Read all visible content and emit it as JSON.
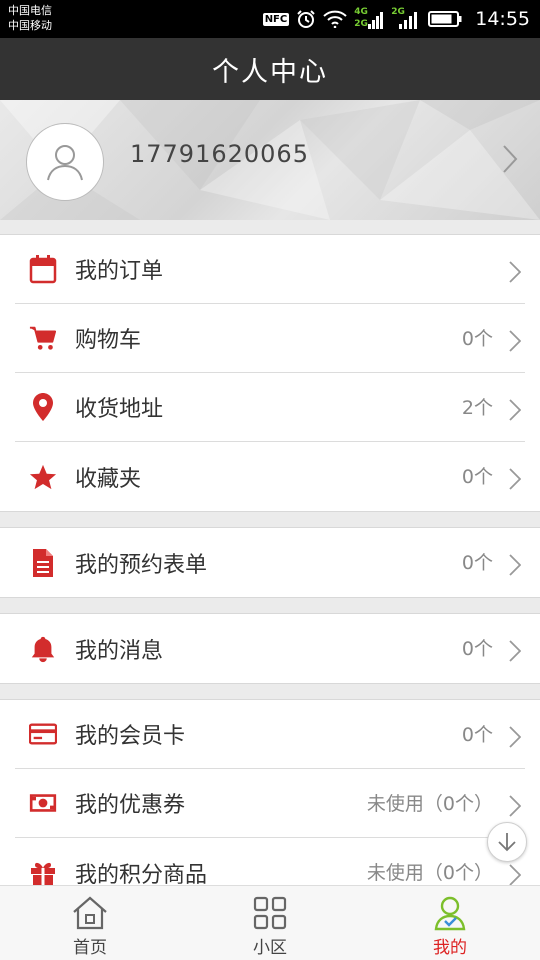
{
  "status_bar": {
    "carrier1": "中国电信",
    "carrier2": "中国移动",
    "nfc": "NFC",
    "net1": "4G",
    "net1b": "2G",
    "net2": "2G",
    "time": "14:55"
  },
  "header": {
    "title": "个人中心"
  },
  "profile": {
    "phone": "17791620065"
  },
  "accent_color": "#d22c2c",
  "sections": [
    {
      "items": [
        {
          "icon": "calendar-icon",
          "label": "我的订单",
          "count": ""
        },
        {
          "icon": "cart-icon",
          "label": "购物车",
          "count": "0个"
        },
        {
          "icon": "location-pin-icon",
          "label": "收货地址",
          "count": "2个"
        },
        {
          "icon": "star-icon",
          "label": "收藏夹",
          "count": "0个"
        }
      ]
    },
    {
      "items": [
        {
          "icon": "document-icon",
          "label": "我的预约表单",
          "count": "0个"
        }
      ]
    },
    {
      "items": [
        {
          "icon": "bell-icon",
          "label": "我的消息",
          "count": "0个"
        }
      ]
    },
    {
      "items": [
        {
          "icon": "card-icon",
          "label": "我的会员卡",
          "count": "0个"
        },
        {
          "icon": "coupon-icon",
          "label": "我的优惠券",
          "count": "未使用（0个）"
        },
        {
          "icon": "gift-icon",
          "label": "我的积分商品",
          "count": "未使用（0个）"
        }
      ]
    }
  ],
  "bottom_nav": {
    "items": [
      {
        "icon": "home-icon",
        "label": "首页"
      },
      {
        "icon": "grid-icon",
        "label": "小区"
      },
      {
        "icon": "profile-icon",
        "label": "我的",
        "active": true
      }
    ]
  }
}
